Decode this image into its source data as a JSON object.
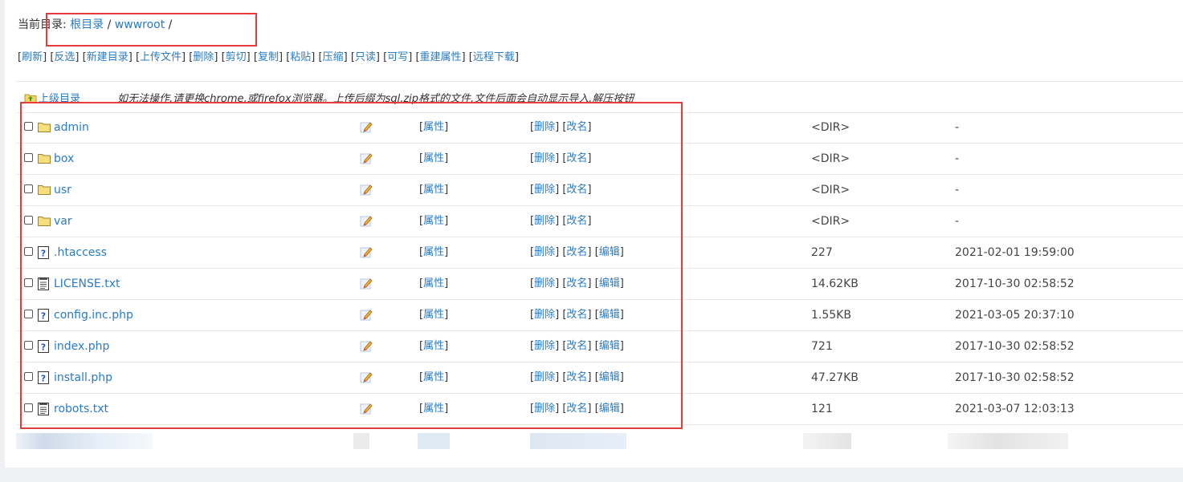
{
  "breadcrumb": {
    "label": "当前目录:",
    "root": "根目录",
    "sep1": " / ",
    "dir": "wwwroot",
    "sep2": " /"
  },
  "toolbar": [
    "刷新",
    "反选",
    "新建目录",
    "上传文件",
    "删除",
    "剪切",
    "复制",
    "粘贴",
    "压缩",
    "只读",
    "可写",
    "重建属性",
    "远程下载"
  ],
  "parent": {
    "label": "上级目录",
    "note": "如无法操作,请更换chrome,或firefox浏览器。上传后缀为sql,zip格式的文件,文件后面会自动显示导入,解压按钮"
  },
  "labels": {
    "attr": "属性",
    "delete": "删除",
    "rename": "改名",
    "edit": "编辑"
  },
  "files": [
    {
      "name": "admin",
      "type": "folder",
      "size": "<DIR>",
      "mtime": "-"
    },
    {
      "name": "box",
      "type": "folder",
      "size": "<DIR>",
      "mtime": "-"
    },
    {
      "name": "usr",
      "type": "folder",
      "size": "<DIR>",
      "mtime": "-"
    },
    {
      "name": "var",
      "type": "folder",
      "size": "<DIR>",
      "mtime": "-"
    },
    {
      "name": ".htaccess",
      "type": "unknown",
      "size": "227",
      "mtime": "2021-02-01 19:59:00"
    },
    {
      "name": "LICENSE.txt",
      "type": "text",
      "size": "14.62KB",
      "mtime": "2017-10-30 02:58:52"
    },
    {
      "name": "config.inc.php",
      "type": "unknown",
      "size": "1.55KB",
      "mtime": "2021-03-05 20:37:10"
    },
    {
      "name": "index.php",
      "type": "unknown",
      "size": "721",
      "mtime": "2017-10-30 02:58:52"
    },
    {
      "name": "install.php",
      "type": "unknown",
      "size": "47.27KB",
      "mtime": "2017-10-30 02:58:52"
    },
    {
      "name": "robots.txt",
      "type": "text",
      "size": "121",
      "mtime": "2021-03-07 12:03:13"
    }
  ],
  "colors": {
    "link": "#2b7bc1",
    "highlight": "#e53b3b"
  }
}
